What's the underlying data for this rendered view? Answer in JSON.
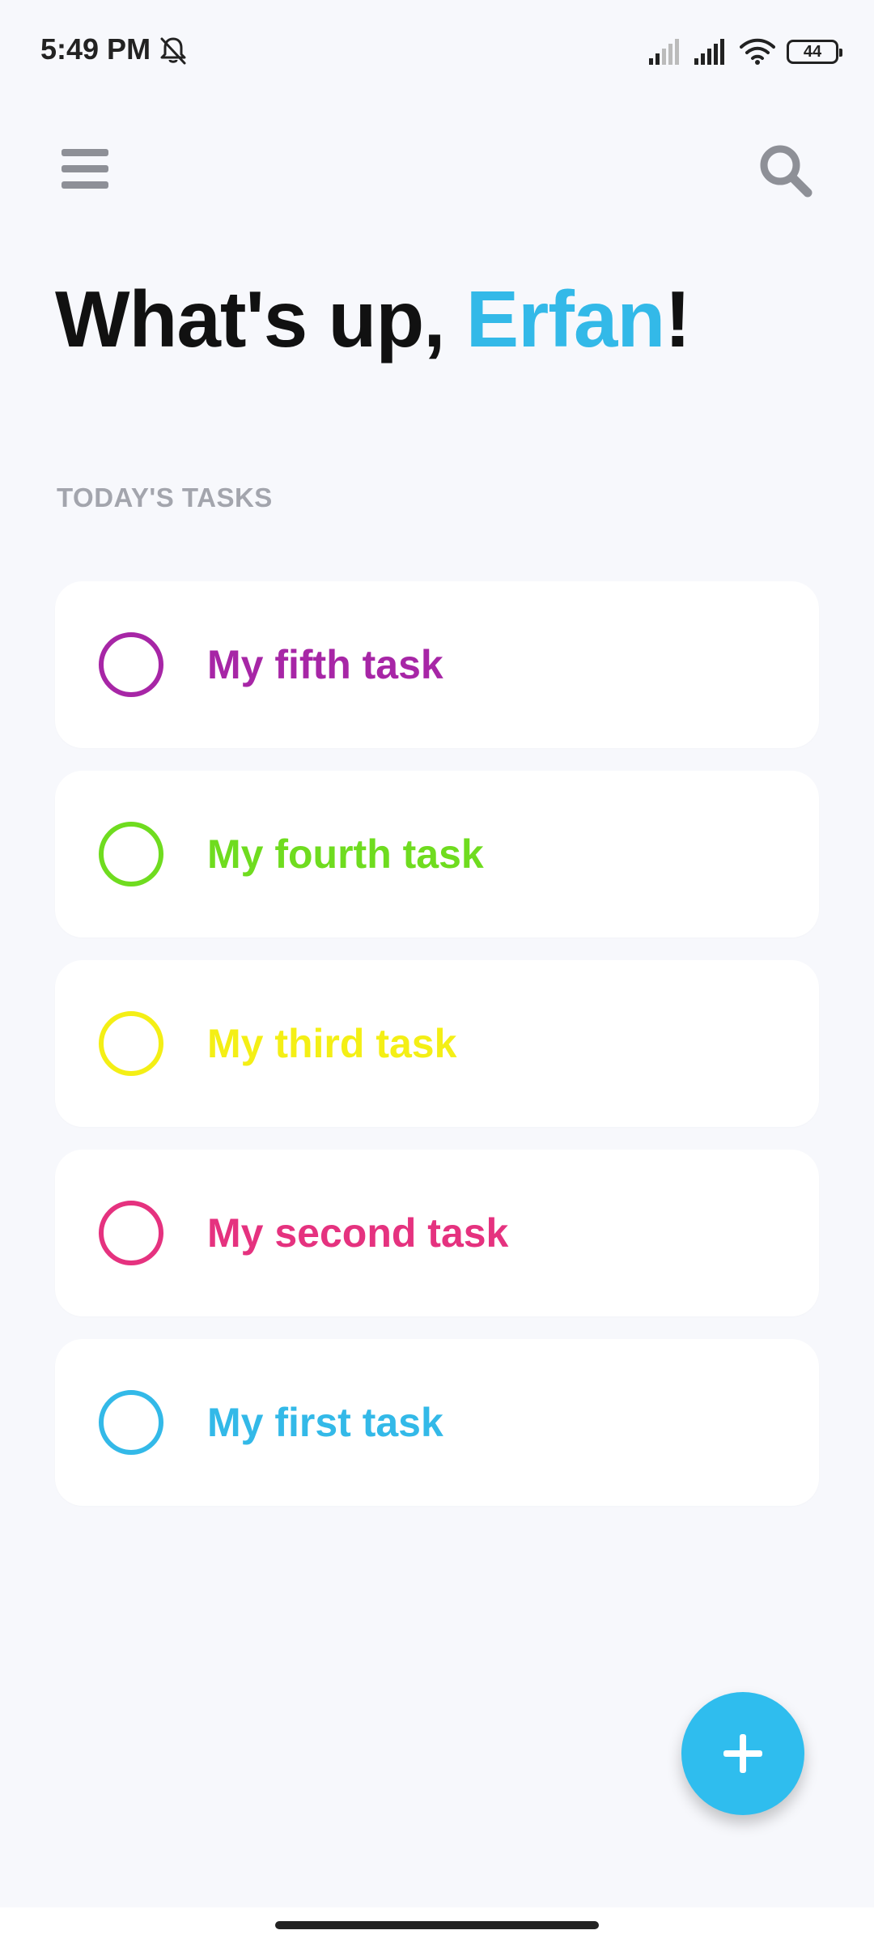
{
  "status_bar": {
    "time": "5:49 PM",
    "battery_level": "44",
    "icons": [
      "bell-off-icon",
      "signal-weak-icon",
      "signal-strong-icon",
      "wifi-icon",
      "battery-icon"
    ]
  },
  "header": {
    "menu_icon": "menu-icon",
    "search_icon": "search-icon"
  },
  "greeting": {
    "prefix": "What's up, ",
    "name": "Erfan",
    "suffix": "!",
    "name_color": "#33b9e8"
  },
  "section_label": "TODAY'S TASKS",
  "tasks": [
    {
      "title": "My fifth task",
      "color": "#a726a6",
      "completed": false
    },
    {
      "title": "My fourth task",
      "color": "#6fdc1f",
      "completed": false
    },
    {
      "title": "My third task",
      "color": "#f4ef15",
      "completed": false
    },
    {
      "title": "My second task",
      "color": "#e5327f",
      "completed": false
    },
    {
      "title": "My first task",
      "color": "#33b9e8",
      "completed": false
    }
  ],
  "fab": {
    "icon": "plus-icon",
    "color": "#2fbdee"
  }
}
